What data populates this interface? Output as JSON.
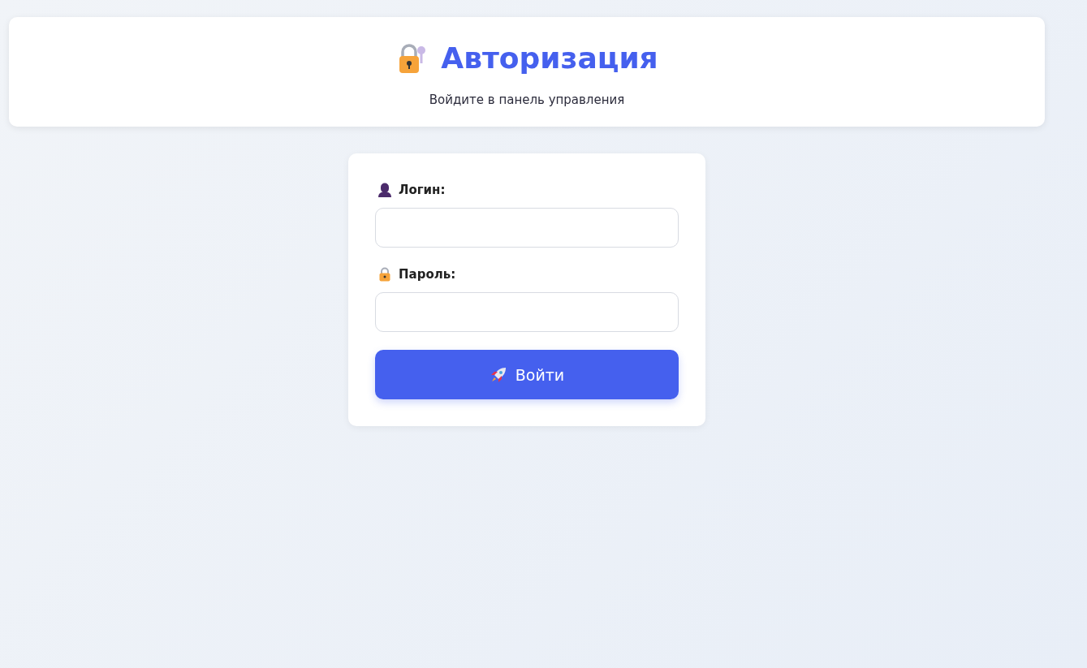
{
  "header": {
    "title": "Авторизация",
    "subtitle": "Войдите в панель управления"
  },
  "form": {
    "fields": [
      {
        "kind": "login",
        "label": "Логин:"
      },
      {
        "kind": "password",
        "label": "Пароль:"
      }
    ],
    "submit": {
      "label": "Войти"
    }
  }
}
